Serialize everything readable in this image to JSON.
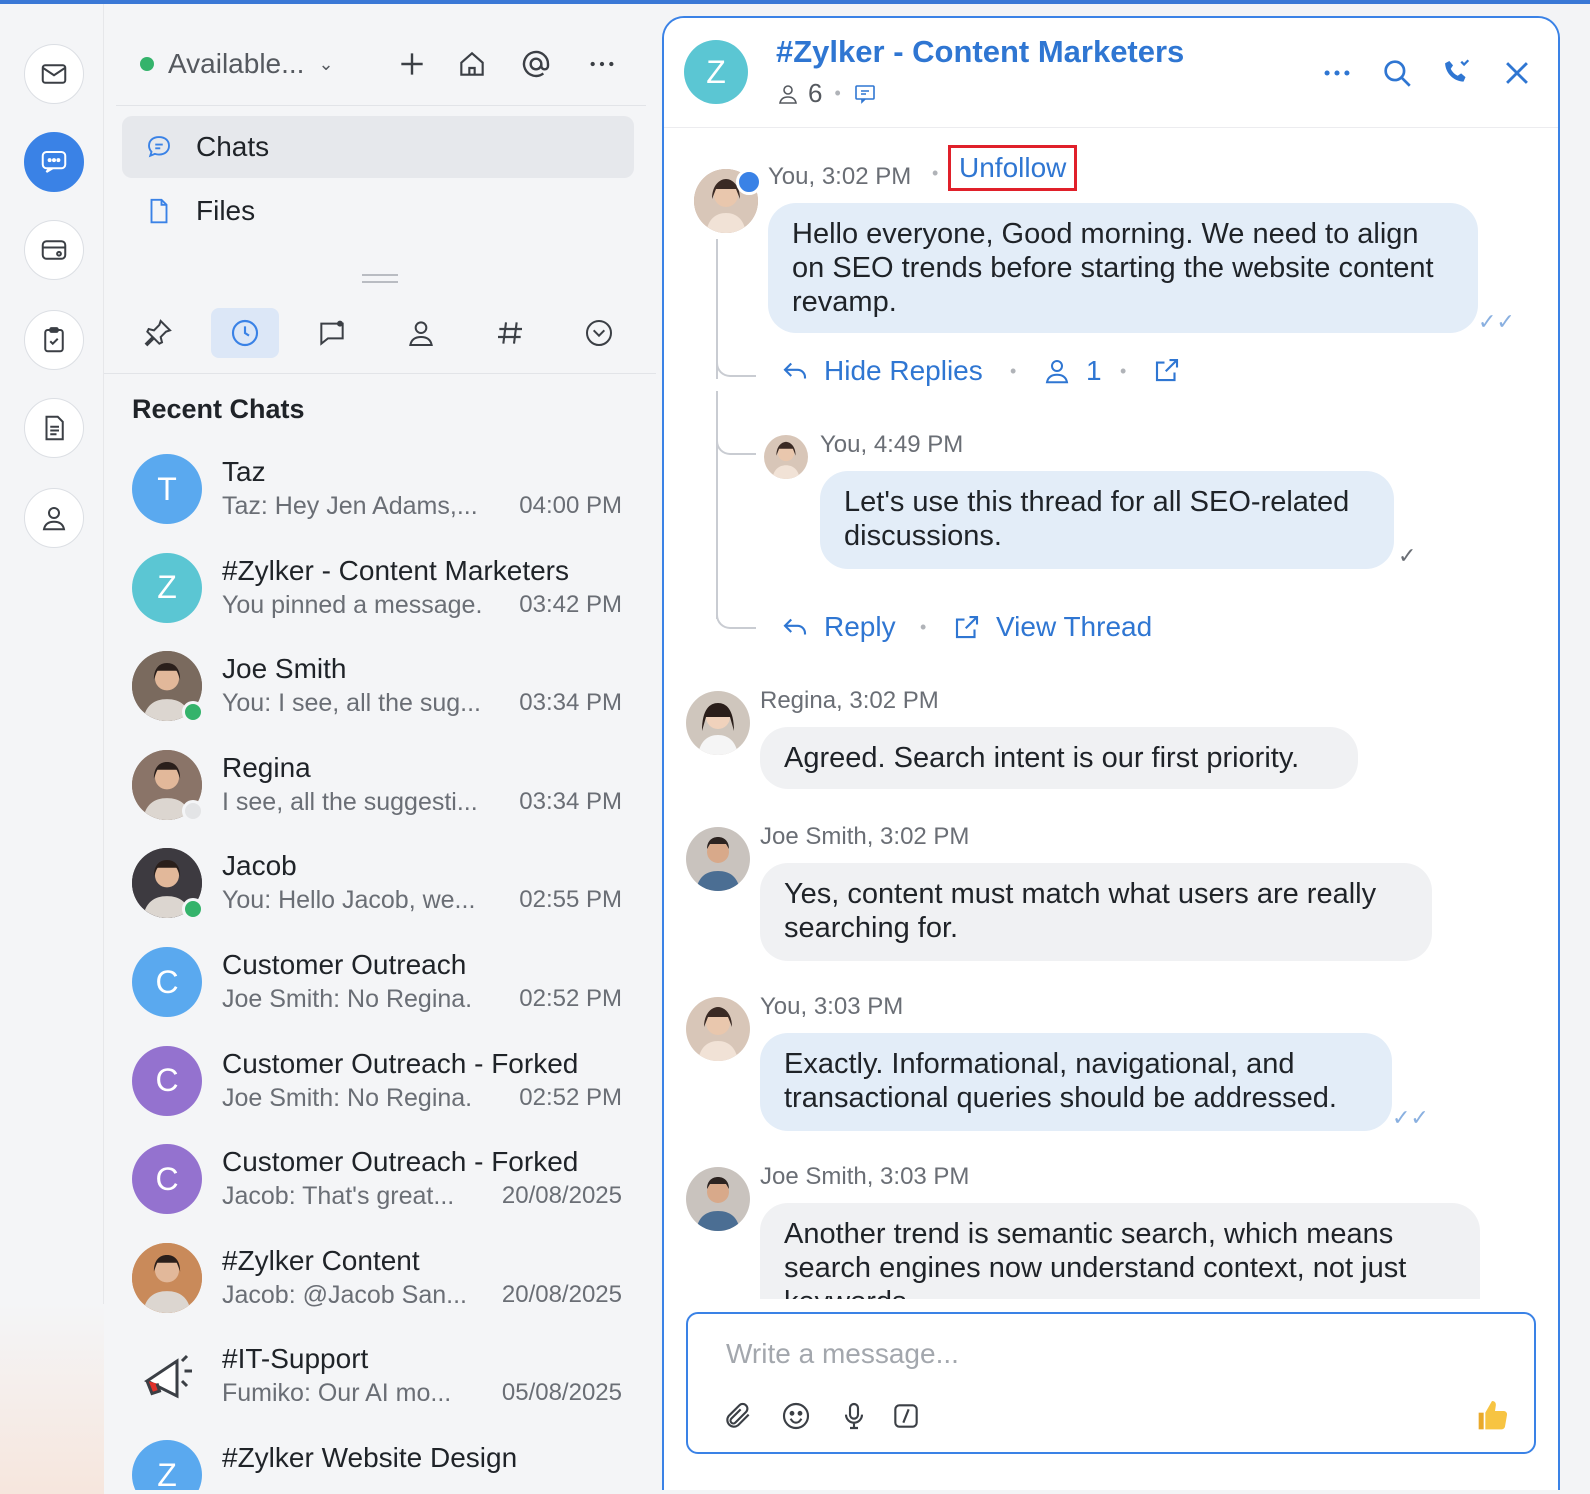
{
  "status": {
    "label": "Available...",
    "color": "#34b36b"
  },
  "nav": [
    {
      "label": "Chats",
      "icon": "chat-bubble-icon",
      "selected": true
    },
    {
      "label": "Files",
      "icon": "file-icon",
      "selected": false
    }
  ],
  "recent": {
    "title": "Recent Chats",
    "items": [
      {
        "name": "Taz",
        "preview": "Taz: Hey Jen Adams,...",
        "time": "04:00 PM",
        "initial": "T",
        "color": "#5aa9ef"
      },
      {
        "name": "#Zylker - Content Marketers",
        "preview": "You pinned a message.",
        "time": "03:42 PM",
        "initial": "Z",
        "color": "#5bc6d3"
      },
      {
        "name": "Joe Smith",
        "preview": "You: I see, all the sug...",
        "time": "03:34 PM",
        "initial": "",
        "color": "#7a6a5e",
        "presence": "#34b36b"
      },
      {
        "name": "Regina",
        "preview": "I see, all the suggesti...",
        "time": "03:34 PM",
        "initial": "",
        "color": "#8a7468",
        "presence": "#e3e4e6"
      },
      {
        "name": "Jacob",
        "preview": "You: Hello Jacob, we...",
        "time": "02:55 PM",
        "initial": "",
        "color": "#3d3a40",
        "presence": "#34b36b"
      },
      {
        "name": "Customer Outreach",
        "preview": "Joe Smith: No Regina.",
        "time": "02:52 PM",
        "initial": "C",
        "color": "#5aa9ef"
      },
      {
        "name": "Customer Outreach - Forked",
        "preview": "Joe Smith: No Regina.",
        "time": "02:52 PM",
        "initial": "C",
        "color": "#9472cf"
      },
      {
        "name": "Customer Outreach - Forked",
        "preview": "Jacob: That's great...",
        "time": "20/08/2025",
        "initial": "C",
        "color": "#9472cf"
      },
      {
        "name": "#Zylker Content",
        "preview": "Jacob: @Jacob San...",
        "time": "20/08/2025",
        "initial": "",
        "color": "#c98a5a"
      },
      {
        "name": "#IT-Support",
        "preview": "Fumiko: Our AI mo...",
        "time": "05/08/2025",
        "initial": "",
        "color": "#f4f5f7"
      },
      {
        "name": "#Zylker Website Design",
        "preview": "",
        "time": "",
        "initial": "Z",
        "color": "#5aa9ef"
      }
    ]
  },
  "channel": {
    "initial": "Z",
    "title": "#Zylker - Content Marketers",
    "members": "6"
  },
  "thread": {
    "author_meta": "You, 3:02 PM",
    "unfollow": "Unfollow",
    "text": "Hello everyone, Good morning. We need to align on SEO trends before starting the website content revamp.",
    "hide_replies": "Hide Replies",
    "participants": "1",
    "reply_meta": "You, 4:49 PM",
    "reply_text": "Let's use this thread for all SEO-related discussions.",
    "reply_label": "Reply",
    "view_thread": "View Thread"
  },
  "messages": [
    {
      "meta": "Regina, 3:02 PM",
      "text": "Agreed. Search intent is our first priority."
    },
    {
      "meta": "Joe Smith, 3:02 PM",
      "text": "Yes, content must match what users are really searching for."
    },
    {
      "meta": "You, 3:03 PM",
      "text": "Exactly. Informational, navigational, and transactional queries should be addressed."
    },
    {
      "meta": "Joe Smith, 3:03 PM",
      "text": "Another trend is semantic search, which means search engines now understand context, not just keywords."
    }
  ],
  "composer": {
    "placeholder": "Write a message..."
  },
  "colors": {
    "accent": "#3a82e6",
    "link": "#2f76d2",
    "highlight": "#e0202a"
  }
}
